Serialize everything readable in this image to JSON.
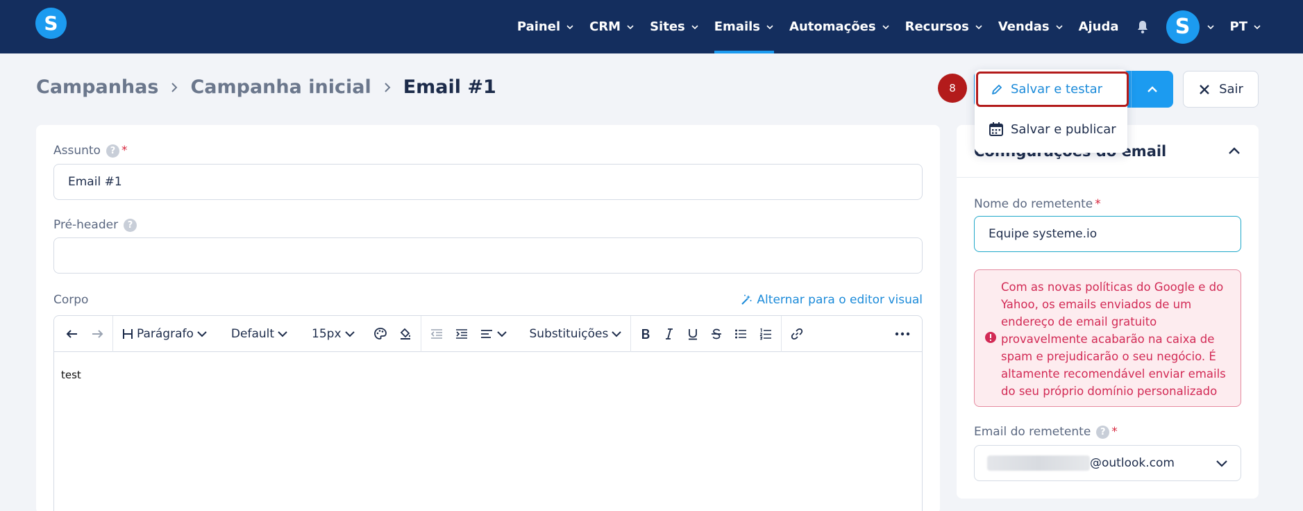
{
  "nav": {
    "logo_letter": "S",
    "items": [
      {
        "label": "Painel",
        "has_dropdown": true
      },
      {
        "label": "CRM",
        "has_dropdown": true
      },
      {
        "label": "Sites",
        "has_dropdown": true
      },
      {
        "label": "Emails",
        "has_dropdown": true,
        "active": true
      },
      {
        "label": "Automações",
        "has_dropdown": true
      },
      {
        "label": "Recursos",
        "has_dropdown": true
      },
      {
        "label": "Vendas",
        "has_dropdown": true
      },
      {
        "label": "Ajuda",
        "has_dropdown": false
      }
    ],
    "avatar_letter": "S",
    "language": "PT"
  },
  "breadcrumb": {
    "items": [
      "Campanhas",
      "Campanha inicial",
      "Email #1"
    ]
  },
  "actions": {
    "step_badge": "8",
    "exit_label": "Sair",
    "menu": {
      "save_test": "Salvar e testar",
      "save_publish": "Salvar e publicar"
    }
  },
  "form": {
    "subject_label": "Assunto",
    "subject_value": "Email #1",
    "preheader_label": "Pré-header",
    "preheader_value": "",
    "body_label": "Corpo",
    "visual_editor_link": "Alternar para o editor visual",
    "help_glyph": "?",
    "required_mark": "*"
  },
  "toolbar": {
    "paragraph": "Parágrafo",
    "font": "Default",
    "size": "15px",
    "substitutions": "Substituições"
  },
  "editor": {
    "content": "test"
  },
  "side": {
    "title": "Configurações do email",
    "sender_name_label": "Nome do remetente",
    "sender_name_value": "Equipe systeme.io",
    "alert_text": "Com as novas políticas do Google e do Yahoo, os emails enviados de um endereço de email gratuito provavelmente acabarão na caixa de spam e prejudicarão o seu negócio. É altamente recomendável enviar emails do seu próprio domínio personalizado",
    "sender_email_label": "Email do remetente",
    "sender_email_suffix": "@outlook.com"
  },
  "colors": {
    "nav_bg": "#142e5e",
    "accent": "#1c9bf0",
    "alert_text": "#d22a55",
    "highlight_border": "#b31b1b"
  }
}
